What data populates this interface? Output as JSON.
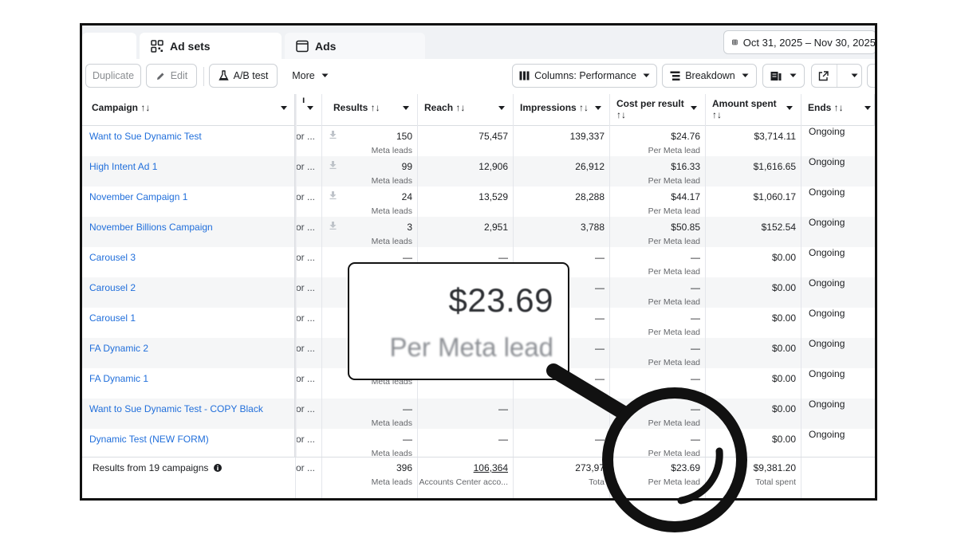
{
  "tabs": {
    "adsets_label": "Ad sets",
    "ads_label": "Ads"
  },
  "date_range": "Oct 31, 2025 – Nov 30, 2025",
  "toolbar": {
    "duplicate": "Duplicate",
    "edit": "Edit",
    "ab_test": "A/B test",
    "more": "More",
    "columns": "Columns: Performance",
    "breakdown": "Breakdown"
  },
  "columns": {
    "campaign": "Campaign ↑↓",
    "results": "Results ↑↓",
    "reach": "Reach ↑↓",
    "impressions": "Impressions ↑↓",
    "cost": "Cost per result",
    "cost_sort": "↑↓",
    "amount": "Amount spent",
    "amount_sort": "↑↓",
    "ends": "Ends ↑↓"
  },
  "rows": [
    {
      "name": "Want to Sue Dynamic Test",
      "trunc": "or ...",
      "results": "150",
      "results_sub": "Meta leads",
      "reach": "75,457",
      "impressions": "139,337",
      "cost": "$24.76",
      "cost_sub": "Per Meta lead",
      "amount": "$3,714.11",
      "ends": "Ongoing"
    },
    {
      "name": "High Intent Ad 1",
      "trunc": "or ...",
      "results": "99",
      "results_sub": "Meta leads",
      "reach": "12,906",
      "impressions": "26,912",
      "cost": "$16.33",
      "cost_sub": "Per Meta lead",
      "amount": "$1,616.65",
      "ends": "Ongoing"
    },
    {
      "name": "November Campaign 1",
      "trunc": "or ...",
      "results": "24",
      "results_sub": "Meta leads",
      "reach": "13,529",
      "impressions": "28,288",
      "cost": "$44.17",
      "cost_sub": "Per Meta lead",
      "amount": "$1,060.17",
      "ends": "Ongoing"
    },
    {
      "name": "November Billions Campaign",
      "trunc": "or ...",
      "results": "3",
      "results_sub": "Meta leads",
      "reach": "2,951",
      "impressions": "3,788",
      "cost": "$50.85",
      "cost_sub": "Per Meta lead",
      "amount": "$152.54",
      "ends": "Ongoing"
    },
    {
      "name": "Carousel 3",
      "trunc": "or ...",
      "results": "—",
      "results_sub": "",
      "reach": "—",
      "impressions": "—",
      "cost": "—",
      "cost_sub": "Per Meta lead",
      "amount": "$0.00",
      "ends": "Ongoing"
    },
    {
      "name": "Carousel 2",
      "trunc": "or ...",
      "results": "",
      "results_sub": "",
      "reach": "",
      "impressions": "—",
      "cost": "—",
      "cost_sub": "Per Meta lead",
      "amount": "$0.00",
      "ends": "Ongoing"
    },
    {
      "name": "Carousel 1",
      "trunc": "or ...",
      "results": "",
      "results_sub": "",
      "reach": "",
      "impressions": "—",
      "cost": "—",
      "cost_sub": "Per Meta lead",
      "amount": "$0.00",
      "ends": "Ongoing"
    },
    {
      "name": "FA Dynamic 2",
      "trunc": "or ...",
      "results": "",
      "results_sub": "",
      "reach": "",
      "impressions": "—",
      "cost": "—",
      "cost_sub": "Per Meta lead",
      "amount": "$0.00",
      "ends": "Ongoing"
    },
    {
      "name": "FA Dynamic 1",
      "trunc": "or ...",
      "results": "",
      "results_sub": "Meta leads",
      "reach": "",
      "impressions": "—",
      "cost": "—",
      "cost_sub": "",
      "amount": "$0.00",
      "ends": "Ongoing"
    },
    {
      "name": "Want to Sue Dynamic Test - COPY Black",
      "trunc": "or ...",
      "results": "—",
      "results_sub": "Meta leads",
      "reach": "—",
      "impressions": "",
      "cost": "—",
      "cost_sub": "Per Meta lead",
      "amount": "$0.00",
      "ends": "Ongoing"
    },
    {
      "name": "Dynamic Test (NEW FORM)",
      "trunc": "or ...",
      "results": "—",
      "results_sub": "Meta leads",
      "reach": "—",
      "impressions": "—",
      "cost": "—",
      "cost_sub": "Per Meta lead",
      "amount": "$0.00",
      "ends": "Ongoing"
    }
  ],
  "summary": {
    "label": "Results from 19 campaigns",
    "trunc": "or ...",
    "results": "396",
    "results_sub": "Meta leads",
    "reach": "106,364",
    "reach_sub": "Accounts Center acco...",
    "impressions": "273,97",
    "impressions_sub": "Tota",
    "cost": "$23.69",
    "cost_sub": "Per Meta lead",
    "amount": "$9,381.20",
    "amount_sub": "Total spent"
  },
  "callout": {
    "value": "$23.69",
    "label": "Per Meta lead"
  },
  "colors": {
    "link": "#216fdb",
    "frame": "#111111",
    "row_alt": "#f5f6f7"
  },
  "icons": [
    "grid-icon",
    "window-icon",
    "calendar-icon",
    "pencil-icon",
    "flask-icon",
    "columns-icon",
    "breakdown-icon",
    "report-icon",
    "export-icon",
    "download-icon",
    "info-icon",
    "magnifier-icon"
  ]
}
